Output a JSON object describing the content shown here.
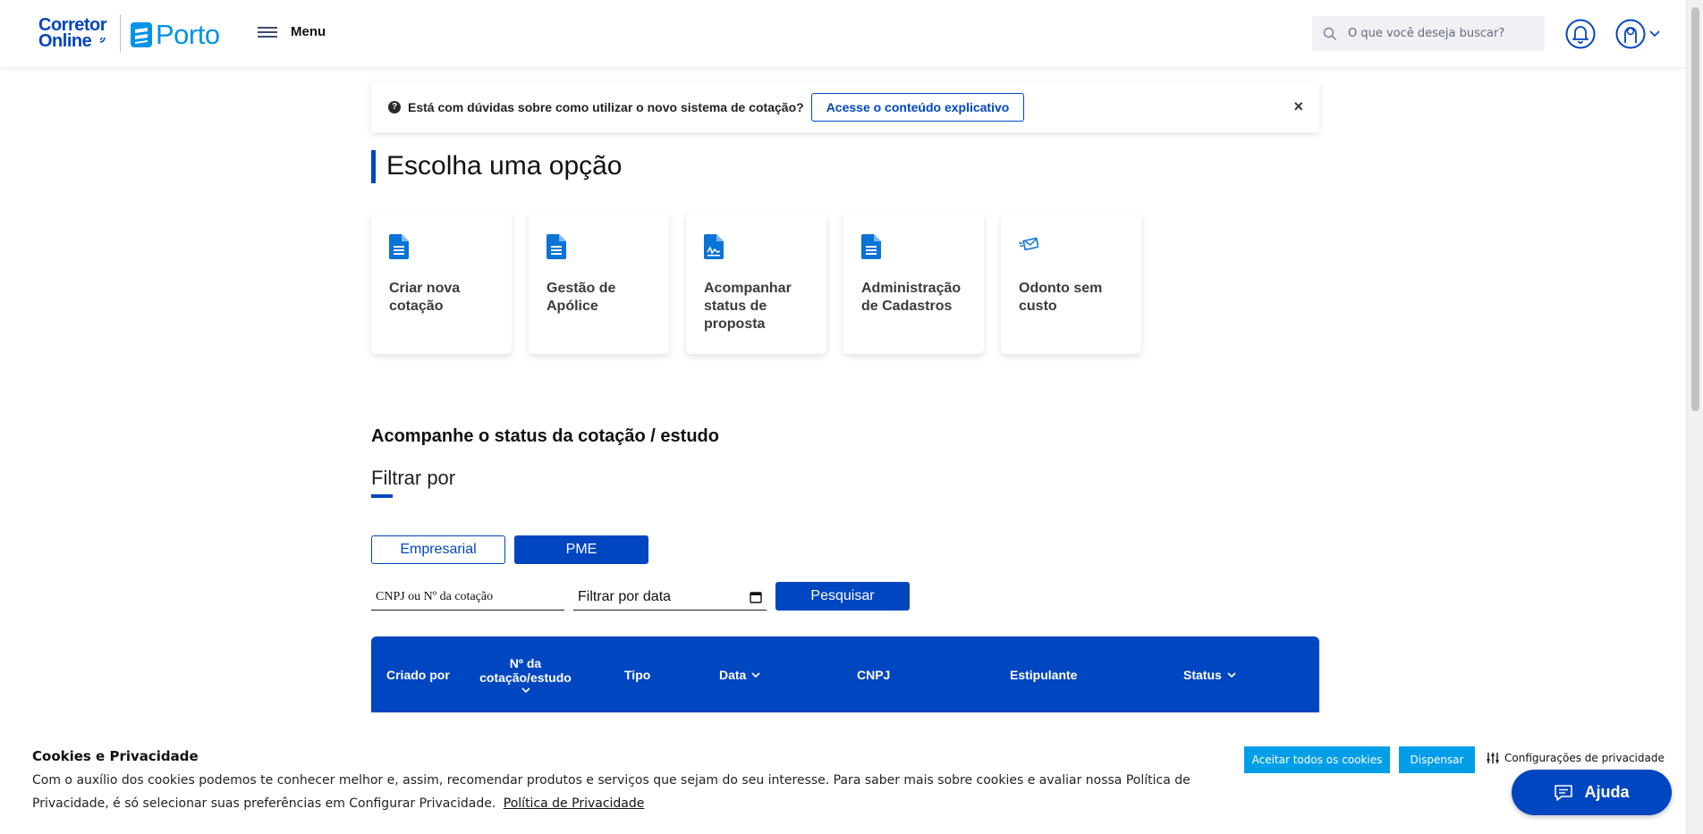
{
  "header": {
    "logo_corretor": "Corretor",
    "logo_online": "Online",
    "logo_porto": "Porto",
    "menu_label": "Menu",
    "search_placeholder": "O que você deseja buscar?"
  },
  "banner": {
    "message": "Está com dúvidas sobre como utilizar o novo sistema de cotação?",
    "link_label": "Acesse o conteúdo explicativo",
    "close": "×"
  },
  "page_title": "Escolha uma opção",
  "cards": [
    {
      "label": "Criar nova cotação",
      "icon": "document-icon"
    },
    {
      "label": "Gestão de Apólice",
      "icon": "document-icon"
    },
    {
      "label": "Acompanhar status de proposta",
      "icon": "signed-document-icon"
    },
    {
      "label": "Administração de Cadastros",
      "icon": "document-icon"
    },
    {
      "label": "Odonto sem custo",
      "icon": "send-mail-icon"
    }
  ],
  "status_section": {
    "title": "Acompanhe o status da cotação / estudo",
    "filter_title": "Filtrar por",
    "tab_empresarial": "Empresarial",
    "tab_pme": "PME",
    "cnpj_placeholder": "CNPJ ou Nº da cotação",
    "date_placeholder": "Filtrar por data",
    "search_button": "Pesquisar"
  },
  "table": {
    "columns": {
      "criado_por": "Criado por",
      "numero_line1": "Nº da",
      "numero_line2": "cotação/estudo",
      "tipo": "Tipo",
      "data": "Data",
      "cnpj": "CNPJ",
      "estipulante": "Estipulante",
      "status": "Status"
    }
  },
  "cookies": {
    "title": "Cookies e Privacidade",
    "text": "Com o auxílio dos cookies podemos te conhecer melhor e, assim, recomendar produtos e serviços que sejam do seu interesse. Para saber mais sobre cookies e avaliar nossa Política de Privacidade, é só selecionar suas preferências em Configurar Privacidade.",
    "policy_link": "Política de Privacidade",
    "accept_all": "Aceitar todos os cookies",
    "dismiss": "Dispensar",
    "settings": "Configurações de privacidade"
  },
  "help_button": "Ajuda",
  "colors": {
    "primary": "#0046c0",
    "porto_blue": "#0093e6",
    "cookie_button": "#009ee8"
  }
}
